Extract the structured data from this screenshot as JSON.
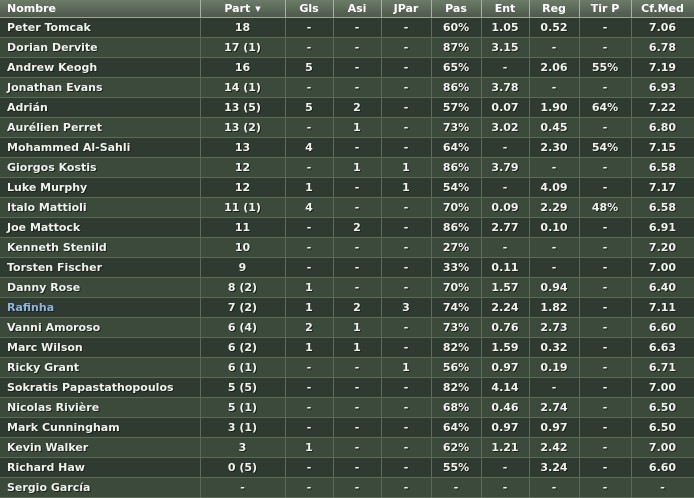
{
  "columns": [
    "Nombre",
    "Part",
    "Gls",
    "Asi",
    "JPar",
    "Pas",
    "Ent",
    "Reg",
    "Tir P",
    "Cf.Med"
  ],
  "sort_icon": "sort-down-triangle-icon",
  "rows": [
    {
      "name": "Peter Tomcak",
      "part": "18",
      "gls": "-",
      "asi": "-",
      "jpar": "-",
      "pas": "60%",
      "ent": "1.05",
      "reg": "0.52",
      "tirp": "-",
      "cfmed": "7.06"
    },
    {
      "name": "Dorian Dervite",
      "part": "17 (1)",
      "gls": "-",
      "asi": "-",
      "jpar": "-",
      "pas": "87%",
      "ent": "3.15",
      "reg": "-",
      "tirp": "-",
      "cfmed": "6.78"
    },
    {
      "name": "Andrew Keogh",
      "part": "16",
      "gls": "5",
      "asi": "-",
      "jpar": "-",
      "pas": "65%",
      "ent": "-",
      "reg": "2.06",
      "tirp": "55%",
      "cfmed": "7.19"
    },
    {
      "name": "Jonathan Evans",
      "part": "14 (1)",
      "gls": "-",
      "asi": "-",
      "jpar": "-",
      "pas": "86%",
      "ent": "3.78",
      "reg": "-",
      "tirp": "-",
      "cfmed": "6.93"
    },
    {
      "name": "Adrián",
      "part": "13 (5)",
      "gls": "5",
      "asi": "2",
      "jpar": "-",
      "pas": "57%",
      "ent": "0.07",
      "reg": "1.90",
      "tirp": "64%",
      "cfmed": "7.22"
    },
    {
      "name": "Aurélien Perret",
      "part": "13 (2)",
      "gls": "-",
      "asi": "1",
      "jpar": "-",
      "pas": "73%",
      "ent": "3.02",
      "reg": "0.45",
      "tirp": "-",
      "cfmed": "6.80"
    },
    {
      "name": "Mohammed Al-Sahli",
      "part": "13",
      "gls": "4",
      "asi": "-",
      "jpar": "-",
      "pas": "64%",
      "ent": "-",
      "reg": "2.30",
      "tirp": "54%",
      "cfmed": "7.15"
    },
    {
      "name": "Giorgos Kostis",
      "part": "12",
      "gls": "-",
      "asi": "1",
      "jpar": "1",
      "pas": "86%",
      "ent": "3.79",
      "reg": "-",
      "tirp": "-",
      "cfmed": "6.58"
    },
    {
      "name": "Luke Murphy",
      "part": "12",
      "gls": "1",
      "asi": "-",
      "jpar": "1",
      "pas": "54%",
      "ent": "-",
      "reg": "4.09",
      "tirp": "-",
      "cfmed": "7.17"
    },
    {
      "name": "Italo Mattioli",
      "part": "11 (1)",
      "gls": "4",
      "asi": "-",
      "jpar": "-",
      "pas": "70%",
      "ent": "0.09",
      "reg": "2.29",
      "tirp": "48%",
      "cfmed": "6.58"
    },
    {
      "name": "Joe Mattock",
      "part": "11",
      "gls": "-",
      "asi": "2",
      "jpar": "-",
      "pas": "86%",
      "ent": "2.77",
      "reg": "0.10",
      "tirp": "-",
      "cfmed": "6.91"
    },
    {
      "name": "Kenneth Stenild",
      "part": "10",
      "gls": "-",
      "asi": "-",
      "jpar": "-",
      "pas": "27%",
      "ent": "-",
      "reg": "-",
      "tirp": "-",
      "cfmed": "7.20"
    },
    {
      "name": "Torsten Fischer",
      "part": "9",
      "gls": "-",
      "asi": "-",
      "jpar": "-",
      "pas": "33%",
      "ent": "0.11",
      "reg": "-",
      "tirp": "-",
      "cfmed": "7.00"
    },
    {
      "name": "Danny Rose",
      "part": "8 (2)",
      "gls": "1",
      "asi": "-",
      "jpar": "-",
      "pas": "70%",
      "ent": "1.57",
      "reg": "0.94",
      "tirp": "-",
      "cfmed": "6.40"
    },
    {
      "name": "Rafinha",
      "part": "7 (2)",
      "gls": "1",
      "asi": "2",
      "jpar": "3",
      "pas": "74%",
      "ent": "2.24",
      "reg": "1.82",
      "tirp": "-",
      "cfmed": "7.11",
      "highlight": true
    },
    {
      "name": "Vanni Amoroso",
      "part": "6 (4)",
      "gls": "2",
      "asi": "1",
      "jpar": "-",
      "pas": "73%",
      "ent": "0.76",
      "reg": "2.73",
      "tirp": "-",
      "cfmed": "6.60"
    },
    {
      "name": "Marc Wilson",
      "part": "6 (2)",
      "gls": "1",
      "asi": "1",
      "jpar": "-",
      "pas": "82%",
      "ent": "1.59",
      "reg": "0.32",
      "tirp": "-",
      "cfmed": "6.63"
    },
    {
      "name": "Ricky Grant",
      "part": "6 (1)",
      "gls": "-",
      "asi": "-",
      "jpar": "1",
      "pas": "56%",
      "ent": "0.97",
      "reg": "0.19",
      "tirp": "-",
      "cfmed": "6.71"
    },
    {
      "name": "Sokratis Papastathopoulos",
      "part": "5 (5)",
      "gls": "-",
      "asi": "-",
      "jpar": "-",
      "pas": "82%",
      "ent": "4.14",
      "reg": "-",
      "tirp": "-",
      "cfmed": "7.00"
    },
    {
      "name": "Nicolas Rivière",
      "part": "5 (1)",
      "gls": "-",
      "asi": "-",
      "jpar": "-",
      "pas": "68%",
      "ent": "0.46",
      "reg": "2.74",
      "tirp": "-",
      "cfmed": "6.50"
    },
    {
      "name": "Mark Cunningham",
      "part": "3 (1)",
      "gls": "-",
      "asi": "-",
      "jpar": "-",
      "pas": "64%",
      "ent": "0.97",
      "reg": "0.97",
      "tirp": "-",
      "cfmed": "6.50"
    },
    {
      "name": "Kevin Walker",
      "part": "3",
      "gls": "1",
      "asi": "-",
      "jpar": "-",
      "pas": "62%",
      "ent": "1.21",
      "reg": "2.42",
      "tirp": "-",
      "cfmed": "7.00"
    },
    {
      "name": "Richard Haw",
      "part": "0 (5)",
      "gls": "-",
      "asi": "-",
      "jpar": "-",
      "pas": "55%",
      "ent": "-",
      "reg": "3.24",
      "tirp": "-",
      "cfmed": "6.60"
    },
    {
      "name": "Sergio García",
      "part": "-",
      "gls": "-",
      "asi": "-",
      "jpar": "-",
      "pas": "-",
      "ent": "-",
      "reg": "-",
      "tirp": "-",
      "cfmed": "-"
    }
  ]
}
